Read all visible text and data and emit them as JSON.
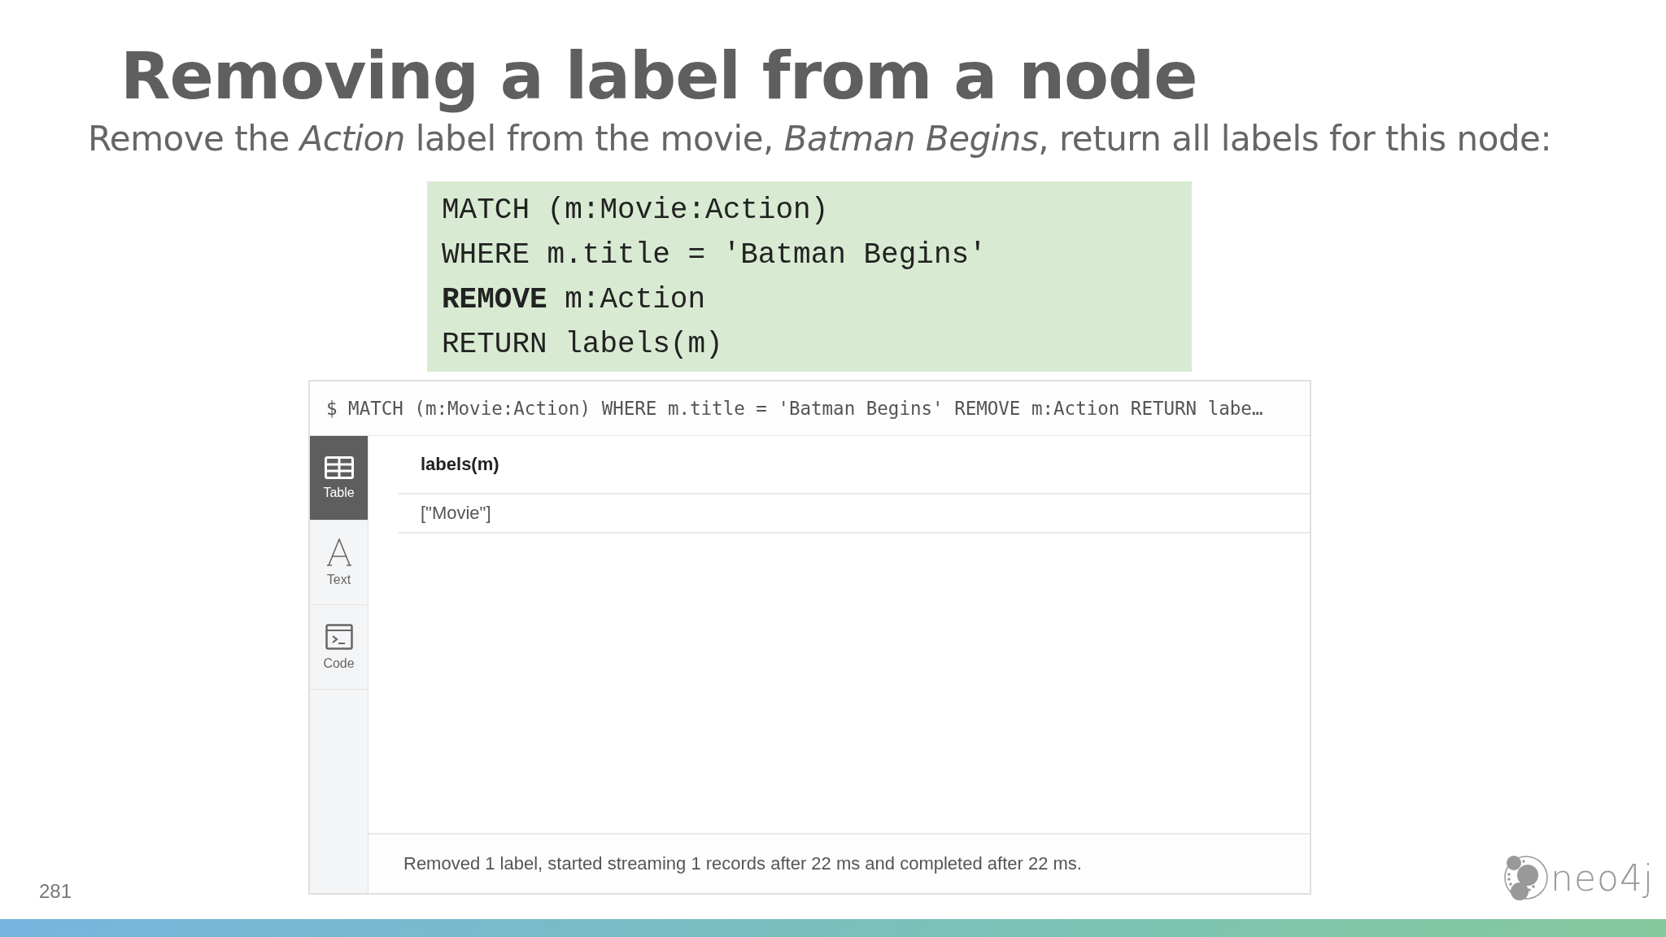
{
  "slide": {
    "title": "Removing a label from a node",
    "subtitle": "Remove the *Action* label from the movie, *Batman Begins*, return all labels for this node:",
    "code_lines": [
      "MATCH (m:Movie:Action)",
      "WHERE m.title = 'Batman Begins'",
      "**REMOVE** m:Action",
      "RETURN labels(m)"
    ],
    "page_number": "281",
    "logo_text": "neo4j"
  },
  "result_frame": {
    "query": "$ MATCH (m:Movie:Action) WHERE m.title = 'Batman Begins' REMOVE m:Action RETURN labe…",
    "view_tabs": [
      {
        "kind": "table",
        "label": "Table",
        "selected": true
      },
      {
        "kind": "text",
        "label": "Text",
        "selected": false
      },
      {
        "kind": "code",
        "label": "Code",
        "selected": false
      }
    ],
    "table": {
      "columns": [
        "labels(m)"
      ],
      "rows": [
        [
          "[\"Movie\"]"
        ]
      ]
    },
    "status_bar": "Removed 1 label, started streaming 1 records after 22 ms and completed after 22 ms."
  }
}
